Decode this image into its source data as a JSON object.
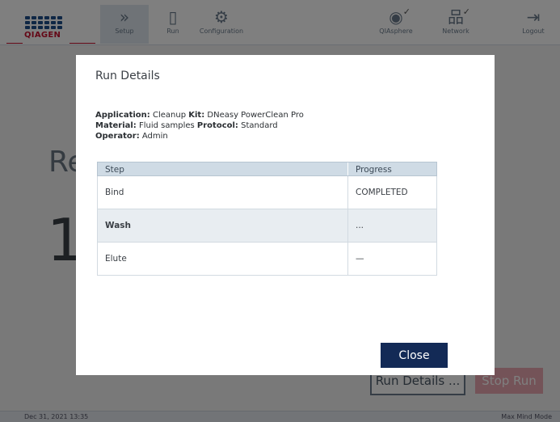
{
  "brand": "QIAGEN",
  "nav": {
    "setup": "Setup",
    "run": "Run",
    "configuration": "Configuration",
    "qiasphere": "QIAsphere",
    "network": "Network",
    "logout": "Logout"
  },
  "background": {
    "title": "Re",
    "number": "1",
    "run_details_button": "Run Details ...",
    "stop_run_button": "Stop Run",
    "status_left": "Dec 31, 2021 13:35",
    "status_right": "Max Mind Mode"
  },
  "modal": {
    "title": "Run Details",
    "meta": {
      "application_label": "Application:",
      "application_value": "Cleanup",
      "kit_label": "Kit:",
      "kit_value": "DNeasy PowerClean Pro",
      "material_label": "Material:",
      "material_value": "Fluid samples",
      "protocol_label": "Protocol:",
      "protocol_value": "Standard",
      "operator_label": "Operator:",
      "operator_value": "Admin"
    },
    "table": {
      "headers": [
        "Step",
        "Progress"
      ],
      "rows": [
        {
          "step": "Bind",
          "progress": "COMPLETED"
        },
        {
          "step": "Wash",
          "progress": "..."
        },
        {
          "step": "Elute",
          "progress": "—"
        }
      ]
    },
    "close_label": "Close"
  },
  "colors": {
    "brand_red": "#c8102e",
    "primary_button": "#132a56",
    "stop_button": "#e9a7b1"
  },
  "icons": {
    "setup": "chevrons-right-icon",
    "run": "run-icon",
    "configuration": "gear-icon",
    "qiasphere": "qiasphere-icon",
    "network": "network-icon",
    "logout": "logout-icon"
  }
}
